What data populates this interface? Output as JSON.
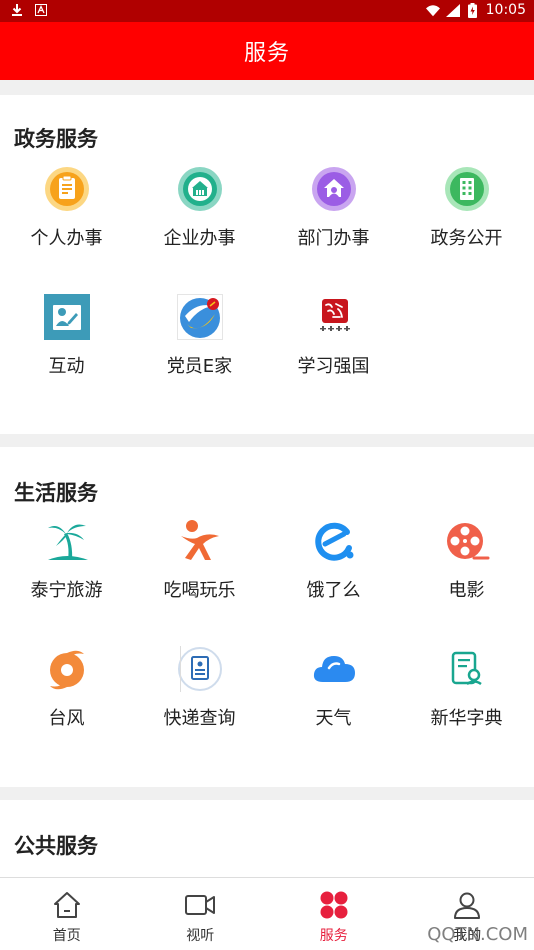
{
  "status_bar": {
    "time": "10:05"
  },
  "header": {
    "title": "服务"
  },
  "sections": [
    {
      "title": "政务服务",
      "items": [
        {
          "label": "个人办事",
          "icon": "personal-affairs-icon"
        },
        {
          "label": "企业办事",
          "icon": "enterprise-affairs-icon"
        },
        {
          "label": "部门办事",
          "icon": "department-affairs-icon"
        },
        {
          "label": "政务公开",
          "icon": "government-disclosure-icon"
        },
        {
          "label": "互动",
          "icon": "interaction-icon"
        },
        {
          "label": "党员E家",
          "icon": "party-member-home-icon"
        },
        {
          "label": "学习强国",
          "icon": "xuexi-qiangguo-icon"
        }
      ]
    },
    {
      "title": "生活服务",
      "items": [
        {
          "label": "泰宁旅游",
          "icon": "palm-tree-icon"
        },
        {
          "label": "吃喝玩乐",
          "icon": "dancing-person-icon"
        },
        {
          "label": "饿了么",
          "icon": "eleme-icon"
        },
        {
          "label": "电影",
          "icon": "film-reel-icon"
        },
        {
          "label": "台风",
          "icon": "typhoon-icon"
        },
        {
          "label": "快递查询",
          "icon": "parcel-document-icon"
        },
        {
          "label": "天气",
          "icon": "cloud-icon"
        },
        {
          "label": "新华字典",
          "icon": "dictionary-icon"
        }
      ]
    },
    {
      "title": "公共服务",
      "items": []
    }
  ],
  "bottom_nav": [
    {
      "label": "首页",
      "icon": "home-icon"
    },
    {
      "label": "视听",
      "icon": "video-camera-icon"
    },
    {
      "label": "服务",
      "icon": "services-grid-icon",
      "active": true
    },
    {
      "label": "我的",
      "icon": "user-icon"
    }
  ],
  "watermark": "QQTN.COM",
  "colors": {
    "header_red": "#ff0000",
    "status_red": "#b00000",
    "active_red": "#e7203e"
  }
}
